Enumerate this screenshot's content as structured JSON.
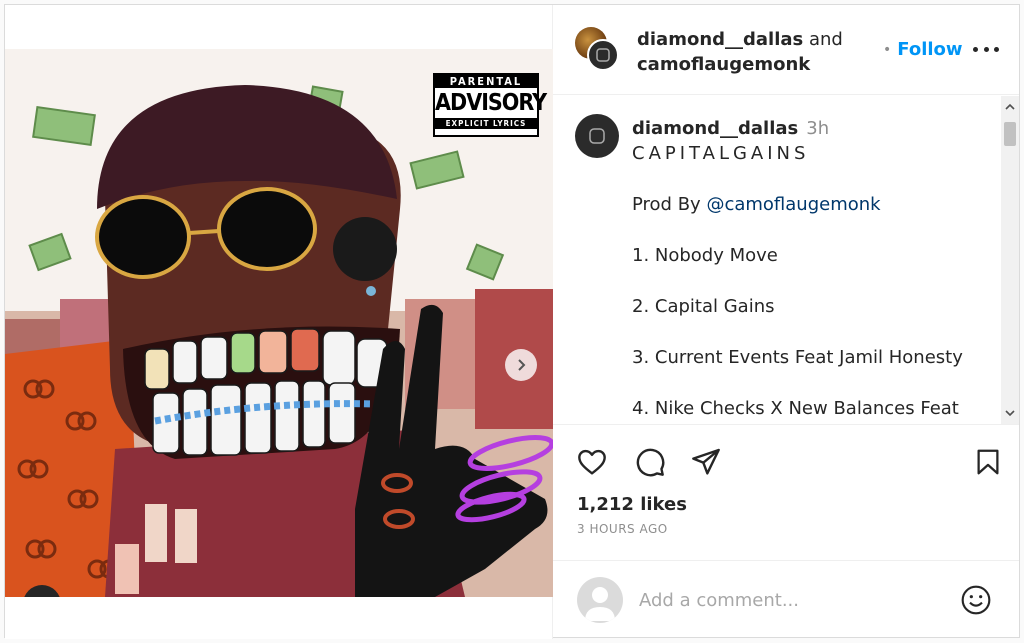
{
  "artwork": {
    "advisory_top": "PARENTAL",
    "advisory_main": "ADVISORY",
    "advisory_bottom": "EXPLICIT LYRICS",
    "carousel_total": 2,
    "carousel_active": 1
  },
  "header": {
    "user1": "diamond__dallas",
    "and": " and",
    "user2": "camoflaugemonk",
    "follow_label": "Follow"
  },
  "caption": {
    "username": "diamond__dallas",
    "time": "3h",
    "title": "CAPITALGAINS",
    "prod_prefix": "Prod By ",
    "prod_mention": "@camoflaugemonk",
    "tracks": [
      "1. Nobody Move",
      "2. Capital Gains",
      "3. Current Events Feat Jamil Honesty",
      "4. Nike Checks X New Balances Feat"
    ]
  },
  "actions": {
    "icons": [
      "heart-icon",
      "comment-icon",
      "share-icon",
      "bookmark-icon"
    ],
    "likes": "1,212 likes",
    "posted": "3 HOURS AGO"
  },
  "comment": {
    "placeholder": "Add a comment..."
  },
  "colors": {
    "accent": "#0095f6",
    "mention": "#00376b",
    "muted": "#8e8e8e",
    "text": "#262626"
  }
}
